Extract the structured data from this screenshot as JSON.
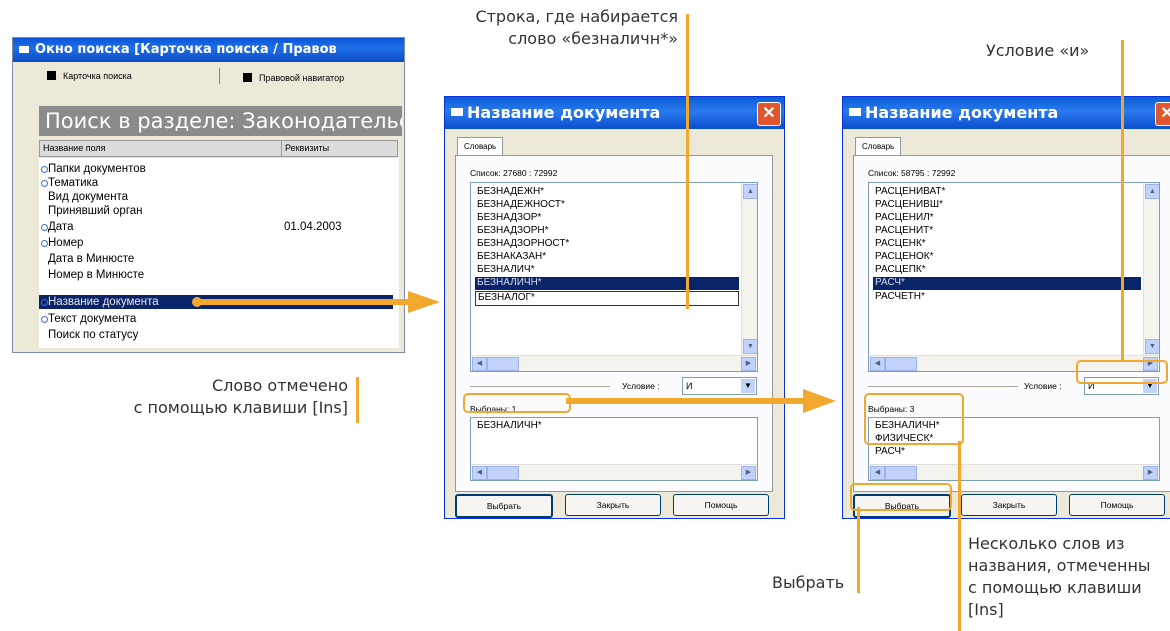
{
  "search_window": {
    "title": "Окно поиска [Карточка поиска / Правов",
    "tabs": [
      "Карточка поиска",
      "Правовой навигатор"
    ],
    "banner": "Поиск в разделе: Законодательс",
    "columns": [
      "Название поля",
      "Реквизиты"
    ],
    "fields": [
      {
        "label": "Папки документов",
        "dot": true,
        "value": ""
      },
      {
        "label": "Тематика",
        "dot": true,
        "value": ""
      },
      {
        "label": "Вид документа",
        "dot": false,
        "value": ""
      },
      {
        "label": "Принявший орган",
        "dot": false,
        "value": ""
      },
      {
        "label": "Дата",
        "dot": true,
        "value": "01.04.2003"
      },
      {
        "label": "Номер",
        "dot": true,
        "value": ""
      },
      {
        "label": "Дата в Минюсте",
        "dot": false,
        "value": ""
      },
      {
        "label": "Номер в Минюсте",
        "dot": false,
        "value": ""
      },
      {
        "label": "Название документа",
        "dot": true,
        "value": "",
        "selected": true
      },
      {
        "label": "Текст документа",
        "dot": true,
        "value": ""
      },
      {
        "label": "Поиск по статусу",
        "dot": false,
        "value": ""
      }
    ]
  },
  "dialog1": {
    "title": "Название документа",
    "close": "✕",
    "tab": "Словарь",
    "list_count": "Список:  27680 : 72992",
    "items": [
      "БЕЗНАДЕЖН*",
      "БЕЗНАДЕЖНОСТ*",
      "БЕЗНАДЗОР*",
      "БЕЗНАДЗОРН*",
      "БЕЗНАДЗОРНОСТ*",
      "БЕЗНАКАЗАН*",
      "БЕЗНАЛИЧ*",
      "БЕЗНАЛИЧН*",
      "БЕЗНАЛОГ*"
    ],
    "selected_index": 7,
    "condition_label": "Условие :",
    "condition_value": "И",
    "chosen_label": "Выбраны:  1",
    "chosen": [
      "БЕЗНАЛИЧН*"
    ],
    "buttons": [
      "Выбрать",
      "Закрыть",
      "Помощь"
    ]
  },
  "dialog2": {
    "title": "Название документа",
    "close": "✕",
    "tab": "Словарь",
    "list_count": "Список:  58795 : 72992",
    "items": [
      "РАСЦЕНИВАТ*",
      "РАСЦЕНИВШ*",
      "РАСЦЕНИЛ*",
      "РАСЦЕНИТ*",
      "РАСЦЕНК*",
      "РАСЦЕНОК*",
      "РАСЦЕПК*",
      "РАСЧ*",
      "РАСЧЕТН*"
    ],
    "selected_index": 7,
    "condition_label": "Условие :",
    "condition_value": "И",
    "chosen_label": "Выбраны:  3",
    "chosen": [
      "БЕЗНАЛИЧН*",
      "ФИЗИЧЕСК*",
      "РАСЧ*"
    ],
    "buttons": [
      "Выбрать",
      "Закрыть",
      "Помощь"
    ]
  },
  "annotations": {
    "typing_line": [
      "Строка, где набирается",
      "слово «безналичн*»"
    ],
    "condition_and": "Условие «и»",
    "marked_word": [
      "Слово отмечено",
      "с помощью клавиши [Ins]"
    ],
    "choose": "Выбрать",
    "several_words": [
      "Несколько слов из",
      "названия, отмеченны",
      "с помощью клавиши",
      "[Ins]"
    ]
  },
  "colors": {
    "accent": "#f2a82e",
    "titlebar": "#0a55d8",
    "selection": "#0a246a"
  }
}
